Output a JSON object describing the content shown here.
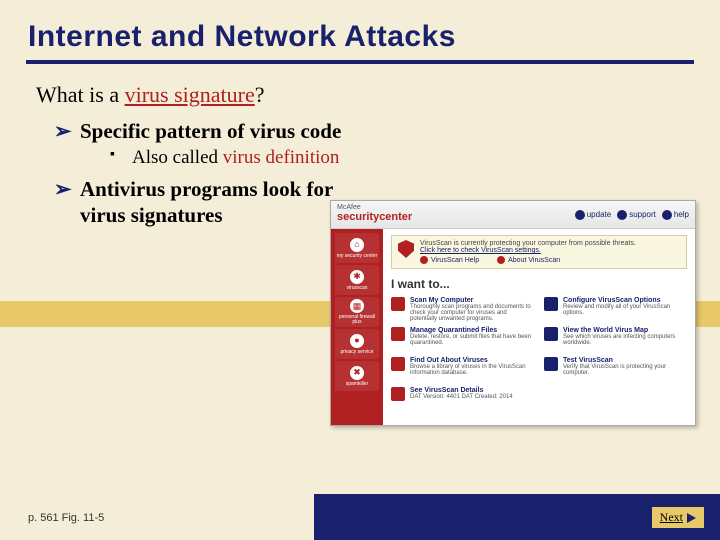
{
  "title": "Internet and Network Attacks",
  "question": {
    "prefix": "What is a ",
    "term": "virus signature",
    "suffix": "?"
  },
  "bullets": {
    "b1": "Specific pattern of virus code",
    "b1_sub_prefix": "Also called ",
    "b1_sub_term": "virus definition",
    "b2": "Antivirus programs look for virus signatures"
  },
  "mock": {
    "brand_small": "McAfee",
    "brand": "securitycenter",
    "hbtn1": "update",
    "hbtn2": "support",
    "hbtn3": "help",
    "banner_line": "VirusScan is currently protecting your computer from possible threats.",
    "banner_sub": "Click here to check VirusScan settings.",
    "link1": "VirusScan Help",
    "link2": "About VirusScan",
    "iwant": "I want to...",
    "side": [
      "my security center",
      "virusscan",
      "personal firewall plus",
      "privacy service",
      "spamkiller"
    ],
    "grid": [
      {
        "t": "Scan My Computer",
        "d": "Thoroughly scan programs and documents to check your computer for viruses and potentially unwanted programs."
      },
      {
        "t": "Configure VirusScan Options",
        "d": "Review and modify all of your VirusScan options."
      },
      {
        "t": "Manage Quarantined Files",
        "d": "Delete, restore, or submit files that have been quarantined."
      },
      {
        "t": "View the World Virus Map",
        "d": "See which viruses are infecting computers worldwide."
      },
      {
        "t": "Find Out About Viruses",
        "d": "Browse a library of viruses in the VirusScan information database."
      },
      {
        "t": "Test VirusScan",
        "d": "Verify that VirusScan is protecting your computer."
      },
      {
        "t": "See VirusScan Details",
        "d": "DAT Version: 4401   DAT Created: 2014"
      }
    ]
  },
  "footer": {
    "pageref": "p. 561 Fig. 11-5",
    "next": "Next"
  }
}
